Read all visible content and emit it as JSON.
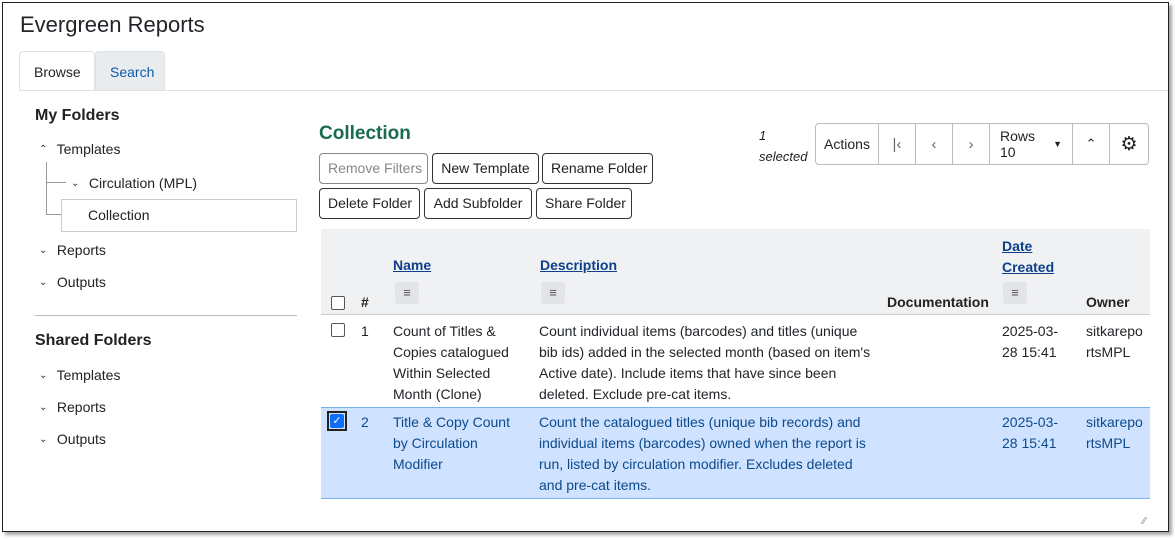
{
  "app": {
    "title": "Evergreen Reports"
  },
  "tabs": [
    {
      "label": "Browse",
      "active": true
    },
    {
      "label": "Search",
      "active": false
    }
  ],
  "sidebar": {
    "my_folders": {
      "title": "My Folders",
      "templates_label": "Templates",
      "circulation_label": "Circulation (MPL)",
      "collection_label": "Collection",
      "reports_label": "Reports",
      "outputs_label": "Outputs"
    },
    "shared_folders": {
      "title": "Shared Folders",
      "templates_label": "Templates",
      "reports_label": "Reports",
      "outputs_label": "Outputs"
    }
  },
  "main": {
    "title": "Collection",
    "buttons": {
      "remove_filters": "Remove Filters",
      "new_template": "New Template",
      "rename_folder": "Rename Folder",
      "delete_folder": "Delete Folder",
      "add_subfolder": "Add Subfolder",
      "share_folder": "Share Folder"
    },
    "selected_count": "1 selected",
    "toolbar": {
      "actions": "Actions",
      "rows": "Rows 10"
    }
  },
  "grid": {
    "columns": {
      "number": "#",
      "name": "Name",
      "description": "Description",
      "documentation": "Documentation",
      "date_created": "Date Created",
      "owner": "Owner"
    },
    "rows": [
      {
        "number": "1",
        "name": "Count of Titles & Copies catalogued Within Selected Month (Clone)",
        "description": "Count individual items (barcodes) and titles (unique bib ids) added in the selected month (based on item's Active date). Include items that have since been deleted. Exclude pre-cat items.",
        "documentation": "",
        "date_created": "2025-03-28 15:41",
        "owner": "sitkareportsMPL",
        "selected": false
      },
      {
        "number": "2",
        "name": "Title & Copy Count by Circulation Modifier",
        "description": "Count the catalogued titles (unique bib records) and individual items (barcodes) owned when the report is run, listed by circulation modifier. Excludes deleted and pre-cat items.",
        "documentation": "",
        "date_created": "2025-03-28 15:41",
        "owner": "sitkareportsMPL",
        "selected": true
      }
    ]
  },
  "colors": {
    "accent": "#1a6b4f",
    "link": "#0d3f8a",
    "selected_row": "#cfe2ff"
  }
}
